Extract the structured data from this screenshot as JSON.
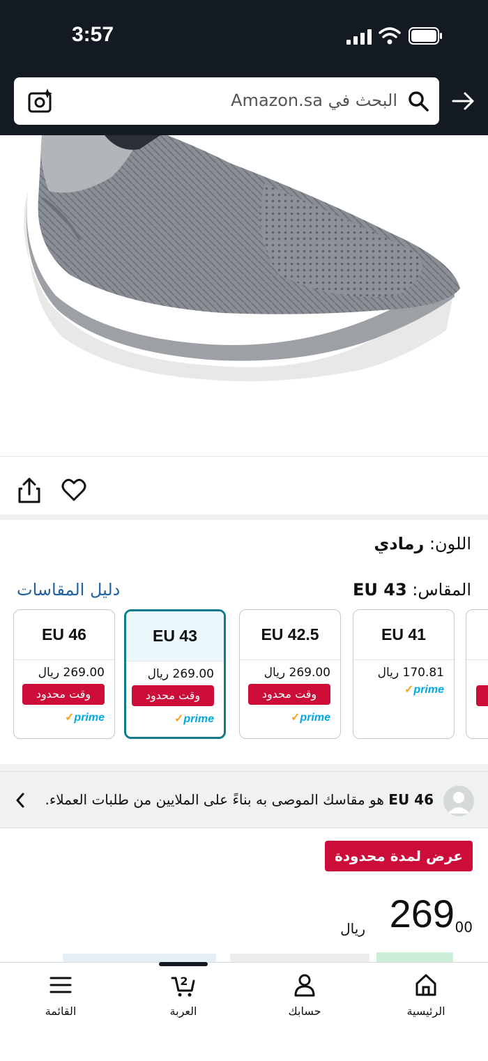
{
  "status_bar": {
    "time": "3:57"
  },
  "search": {
    "placeholder": "البحث في Amazon.sa"
  },
  "product": {
    "color_label": "اللون:",
    "color_value": "رمادي",
    "size_label": "المقاس:",
    "size_value": "EU 43",
    "size_guide": "دليل المقاسات"
  },
  "sizes": [
    {
      "size": "EU 46",
      "price": "269.00 ريال",
      "deal": "وقت محدود",
      "prime": "prime",
      "selected": false
    },
    {
      "size": "EU 43",
      "price": "269.00 ريال",
      "deal": "وقت محدود",
      "prime": "prime",
      "selected": true
    },
    {
      "size": "EU 42.5",
      "price": "269.00 ريال",
      "deal": "وقت محدود",
      "prime": "prime",
      "selected": false
    },
    {
      "size": "EU 41",
      "price": "170.81 ريال",
      "deal": "",
      "prime": "prime",
      "selected": false
    }
  ],
  "recommendation": {
    "size": "EU 46",
    "text": "هو مقاسك الموصى به بناءً على الملايين من طلبات العملاء."
  },
  "offer": {
    "badge": "عرض لمدة محدودة",
    "price_int": "269",
    "price_cents": "00",
    "currency": "ريال"
  },
  "nav": {
    "home": "الرئيسية",
    "account": "حسابك",
    "cart": "العربة",
    "cart_count": "2",
    "menu": "القائمة"
  },
  "colors": {
    "header_bg": "#131a22",
    "deal_red": "#cc0c39",
    "link_blue": "#2162a1",
    "selected_teal": "#117a8b",
    "prime_blue": "#00a8e1"
  }
}
